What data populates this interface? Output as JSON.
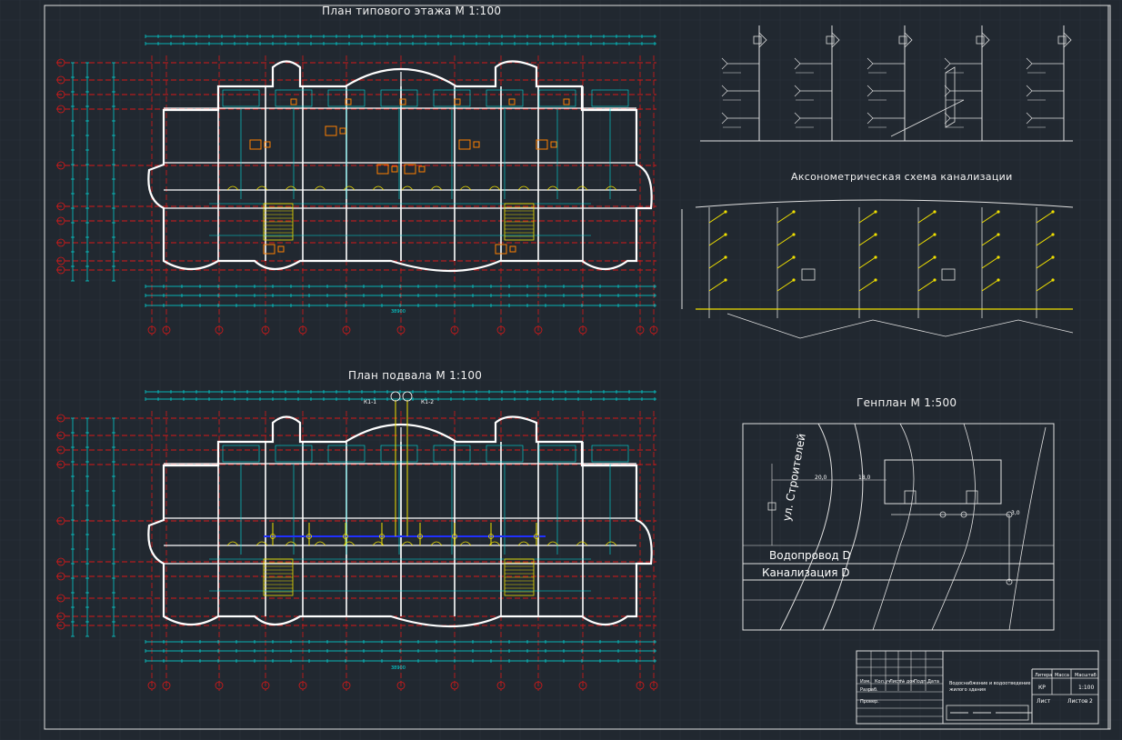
{
  "sheet": {
    "titles": {
      "typical_floor": "План типового этажа М 1:100",
      "basement": "План подвала М 1:100",
      "sewer_axonometric": "Аксонометрическая схема канализации",
      "site_plan": "Генплан М 1:500"
    },
    "site_plan": {
      "street": "ул. Строителей",
      "water_main": "Водопровод D",
      "sewer_main": "Канализация D",
      "dim_a": "20,0",
      "dim_b": "18,0",
      "dim_c": "3,0"
    },
    "basement_inlets": [
      "К1-1",
      "К1-2"
    ],
    "plan_overall_dim": "38900",
    "title_block": {
      "project_text": "Водоснабжение и водоотведение жилого здания",
      "stage_header": "Литера",
      "mass_header": "Масса",
      "scale_header": "Масштаб",
      "stage": "КР",
      "scale": "1:100",
      "sheet_label": "Лист",
      "sheets_label": "Листов",
      "sheets_count": "2",
      "row_labels": [
        "Изм.",
        "Разраб.",
        "Провер."
      ],
      "col_labels": [
        "Кол.уч",
        "Лист",
        "№ док",
        "Подп.",
        "Дата"
      ]
    },
    "colors": {
      "background": "#212830",
      "grid": "#d81818",
      "walls": "#ffffff",
      "dimensions": "#00e0e0",
      "pipes": "#f0e000",
      "sewer_line": "#2030ff",
      "accent": "#ff8000"
    }
  }
}
